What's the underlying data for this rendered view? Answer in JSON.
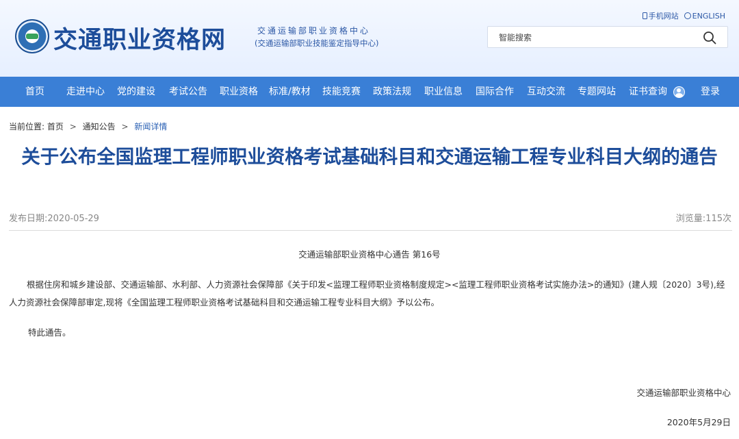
{
  "header": {
    "site_name": "交通职业资格网",
    "org_line1": "交通运输部职业资格中心",
    "org_line2": "(交通运输部职业技能鉴定指导中心)",
    "links": {
      "mobile": "手机网站",
      "english": "ENGLISH"
    },
    "search": {
      "placeholder": "智能搜索"
    }
  },
  "nav": {
    "items": [
      "首页",
      "走进中心",
      "党的建设",
      "考试公告",
      "职业资格",
      "标准/教材",
      "技能竞赛",
      "政策法规",
      "职业信息",
      "国际合作",
      "互动交流",
      "专题网站",
      "证书查询"
    ],
    "login": "登录"
  },
  "breadcrumb": {
    "prefix": "当前位置:",
    "items": [
      "首页",
      "通知公告",
      "新闻详情"
    ],
    "separator": ">"
  },
  "article": {
    "title": "关于公布全国监理工程师职业资格考试基础科目和交通运输工程专业科目大纲的通告",
    "publish_date": "发布日期:2020-05-29",
    "views": "浏览量:115次",
    "doc_number": "交通运输部职业资格中心通告 第16号",
    "paragraph": "根据住房和城乡建设部、交通运输部、水利部、人力资源社会保障部《关于印发<监理工程师职业资格制度规定><监理工程师职业资格考试实施办法>的通知》(建人规〔2020〕3号),经人力资源社会保障部审定,现将《全国监理工程师职业资格考试基础科目和交通运输工程专业科目大纲》予以公布。",
    "closing": "特此通告。",
    "sign_org": "交通运输部职业资格中心",
    "sign_date": "2020年5月29日"
  },
  "colors": {
    "brand_blue": "#1d4d9a",
    "nav_blue": "#3a7fd6",
    "link_blue": "#2b61b4",
    "meta_gray": "#888888"
  }
}
